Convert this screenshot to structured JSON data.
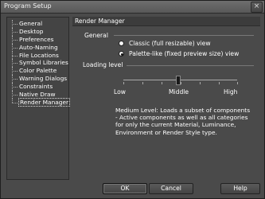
{
  "window": {
    "title": "Program Setup",
    "close_symbol": "×"
  },
  "sidebar": {
    "items": [
      {
        "label": "General"
      },
      {
        "label": "Desktop"
      },
      {
        "label": "Preferences"
      },
      {
        "label": "Auto-Naming"
      },
      {
        "label": "File Locations"
      },
      {
        "label": "Symbol Libraries"
      },
      {
        "label": "Color Palette"
      },
      {
        "label": "Warning Dialogs"
      },
      {
        "label": "Constraints"
      },
      {
        "label": "Native Draw"
      },
      {
        "label": "Render Manager",
        "selected": true
      }
    ]
  },
  "panel": {
    "header": "Render Manager",
    "general": {
      "label": "General",
      "options": [
        {
          "label": "Classic (full resizable) view",
          "checked": false
        },
        {
          "label": "Palette-like (fixed preview size) view",
          "checked": true
        }
      ]
    },
    "loading": {
      "label": "Loading level",
      "ticks": [
        "Low",
        "Middle",
        "High"
      ],
      "value": "Middle",
      "description": "Medium Level: Loads a subset of components - Active components as well as all categories for only the current Material, Luminance, Environment or Render Style type."
    }
  },
  "buttons": {
    "ok": "OK",
    "cancel": "Cancel",
    "help": "Help"
  }
}
